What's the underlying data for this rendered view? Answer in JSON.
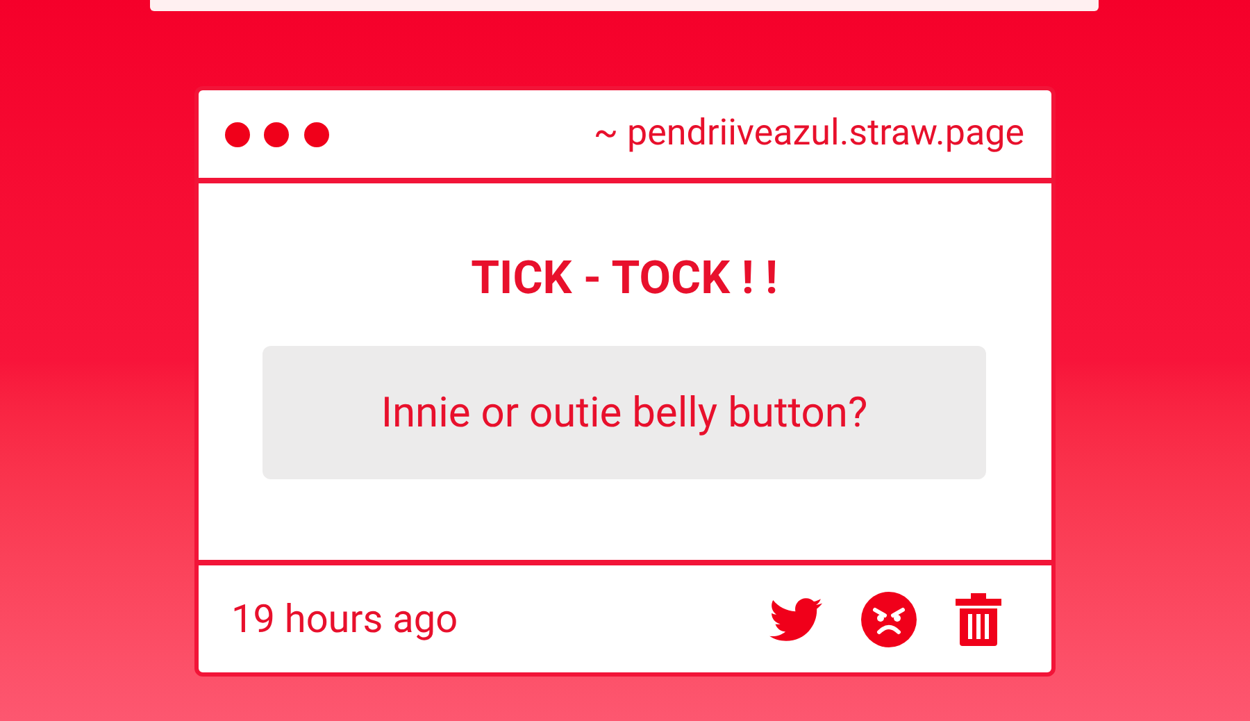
{
  "window": {
    "url": "~ pendriiveazul.straw.page"
  },
  "card": {
    "title": "TICK - TOCK ! !",
    "question": "Innie or outie belly button?",
    "time": "19 hours ago"
  }
}
